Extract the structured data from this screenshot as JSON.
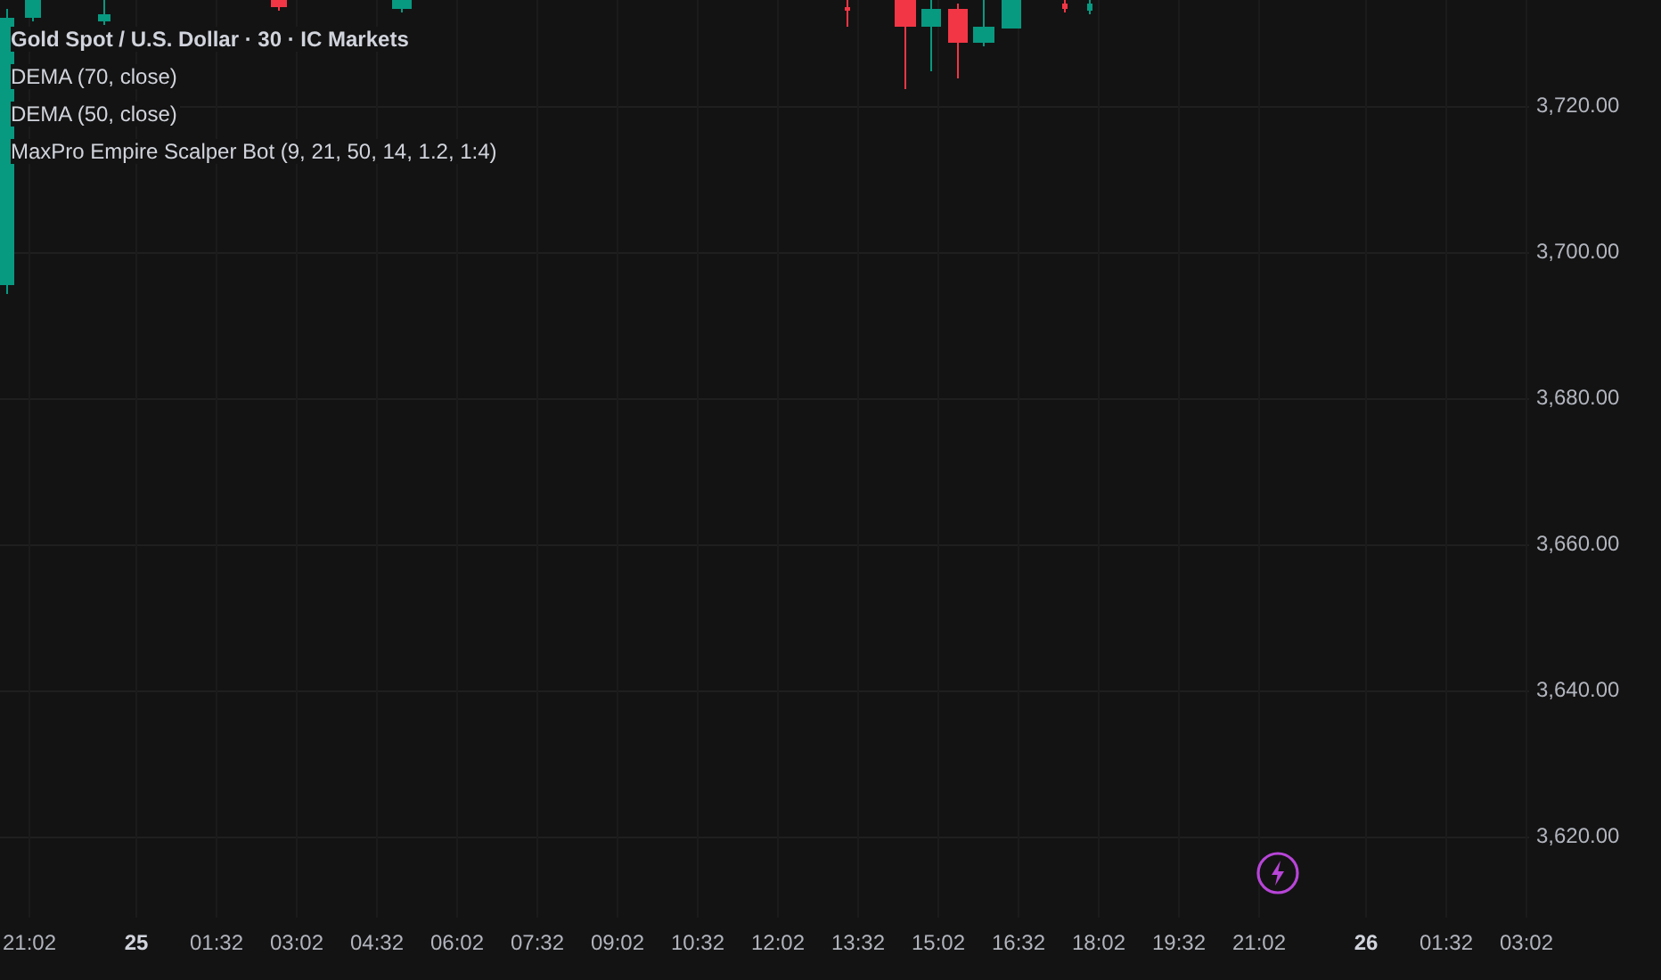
{
  "legend": {
    "title": "Gold Spot / U.S. Dollar · 30 · IC Markets",
    "indicators": [
      "DEMA (70, close)",
      "DEMA (50, close)",
      "MaxPro Empire Scalper Bot (9, 21, 50, 14, 1.2, 1:4)"
    ]
  },
  "price_axis": [
    "3,720.00",
    "3,700.00",
    "3,680.00",
    "3,660.00",
    "3,640.00",
    "3,620.00"
  ],
  "time_axis": [
    {
      "label": "21:02",
      "kind": "time"
    },
    {
      "label": "25",
      "kind": "day"
    },
    {
      "label": "01:32",
      "kind": "time"
    },
    {
      "label": "03:02",
      "kind": "time"
    },
    {
      "label": "04:32",
      "kind": "time"
    },
    {
      "label": "06:02",
      "kind": "time"
    },
    {
      "label": "07:32",
      "kind": "time"
    },
    {
      "label": "09:02",
      "kind": "time"
    },
    {
      "label": "10:32",
      "kind": "time"
    },
    {
      "label": "12:02",
      "kind": "time"
    },
    {
      "label": "13:32",
      "kind": "time"
    },
    {
      "label": "15:02",
      "kind": "time"
    },
    {
      "label": "16:32",
      "kind": "time"
    },
    {
      "label": "18:02",
      "kind": "time"
    },
    {
      "label": "19:32",
      "kind": "time"
    },
    {
      "label": "21:02",
      "kind": "time"
    },
    {
      "label": "26",
      "kind": "day"
    },
    {
      "label": "01:32",
      "kind": "time"
    },
    {
      "label": "03:02",
      "kind": "time"
    }
  ]
}
